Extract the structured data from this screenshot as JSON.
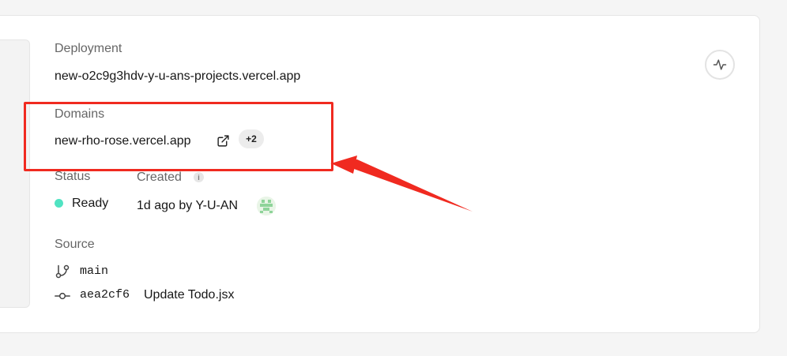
{
  "deployment": {
    "label": "Deployment",
    "url": "new-o2c9g3hdv-y-u-ans-projects.vercel.app"
  },
  "domains": {
    "label": "Domains",
    "primary": "new-rho-rose.vercel.app",
    "extra_count": "+2"
  },
  "status": {
    "label": "Status",
    "value": "Ready",
    "color": "#50e3c2"
  },
  "created": {
    "label": "Created",
    "info_icon": "i",
    "value": "1d ago by Y-U-AN"
  },
  "source": {
    "label": "Source",
    "branch": "main",
    "commit_hash": "aea2cf6",
    "commit_message": "Update Todo.jsx"
  },
  "annotation": {
    "color": "#f02a20"
  },
  "icons": {
    "activity": "activity-icon",
    "external_link": "external-link-icon",
    "branch": "git-branch-icon",
    "commit": "git-commit-icon",
    "info": "info-icon",
    "avatar": "avatar"
  }
}
